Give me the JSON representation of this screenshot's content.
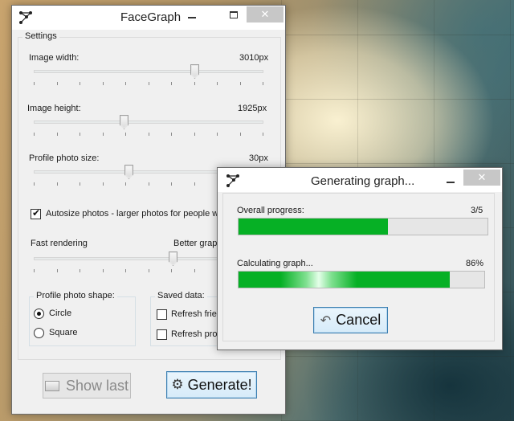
{
  "main_window": {
    "title": "FaceGraph",
    "settings": {
      "group_title": "Settings",
      "image_width": {
        "label": "Image width:",
        "value_text": "3010px",
        "position": 0.71
      },
      "image_height": {
        "label": "Image height:",
        "value_text": "1925px",
        "position": 0.39
      },
      "photo_size": {
        "label": "Profile photo size:",
        "value_text": "30px",
        "position": 0.41
      },
      "autosize": {
        "label": "Autosize photos - larger photos for people with",
        "checked": true
      },
      "quality": {
        "left_label": "Fast rendering",
        "right_label": "Better graph",
        "position": 0.61
      },
      "photo_shape": {
        "group_title": "Profile photo shape:",
        "options": [
          {
            "label": "Circle",
            "checked": true
          },
          {
            "label": "Square",
            "checked": false
          }
        ]
      },
      "saved_data": {
        "group_title": "Saved data:",
        "options": [
          {
            "label": "Refresh frien",
            "checked": false
          },
          {
            "label": "Refresh profi",
            "checked": false
          }
        ]
      }
    },
    "buttons": {
      "show_last": "Show last",
      "generate": "Generate!"
    }
  },
  "progress_dialog": {
    "title": "Generating graph...",
    "overall": {
      "label": "Overall progress:",
      "value_text": "3/5",
      "fraction": 0.6
    },
    "calc": {
      "label": "Calculating graph...",
      "value_text": "86%",
      "fraction": 0.86
    },
    "cancel_label": "Cancel"
  },
  "icons": {
    "app": "facegraph-logo-icon",
    "minimize": "minimize-icon",
    "maximize": "maximize-icon",
    "close": "close-icon",
    "show_last": "image-icon",
    "generate": "gear-icon",
    "cancel": "cancel-arrow-icon"
  },
  "colors": {
    "progress": "#06b025",
    "focus_border": "#3c7fb1"
  }
}
